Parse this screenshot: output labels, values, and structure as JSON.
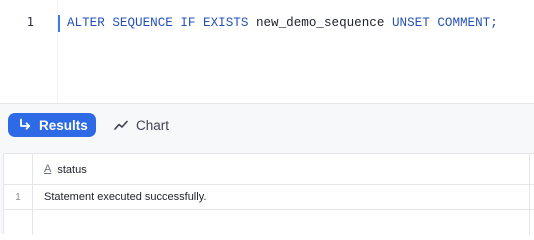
{
  "editor": {
    "line_number": "1",
    "tokens": [
      {
        "text": "ALTER SEQUENCE IF EXISTS ",
        "kind": "keyword"
      },
      {
        "text": "new_demo_sequence",
        "kind": "identifier"
      },
      {
        "text": " UNSET COMMENT;",
        "kind": "keyword"
      }
    ]
  },
  "toolbar": {
    "results_label": "Results",
    "results_icon": "arrow-return-icon",
    "chart_label": "Chart",
    "chart_icon": "line-chart-icon"
  },
  "grid": {
    "columns": [
      {
        "label": "status",
        "type_icon": "A",
        "type_icon_name": "text-type-icon"
      }
    ],
    "rows": [
      {
        "index": "1",
        "status": "Statement executed successfully."
      }
    ]
  },
  "colors": {
    "accent": "#2f6ae6",
    "keyword": "#2450b6",
    "identifier": "#1e2129"
  }
}
